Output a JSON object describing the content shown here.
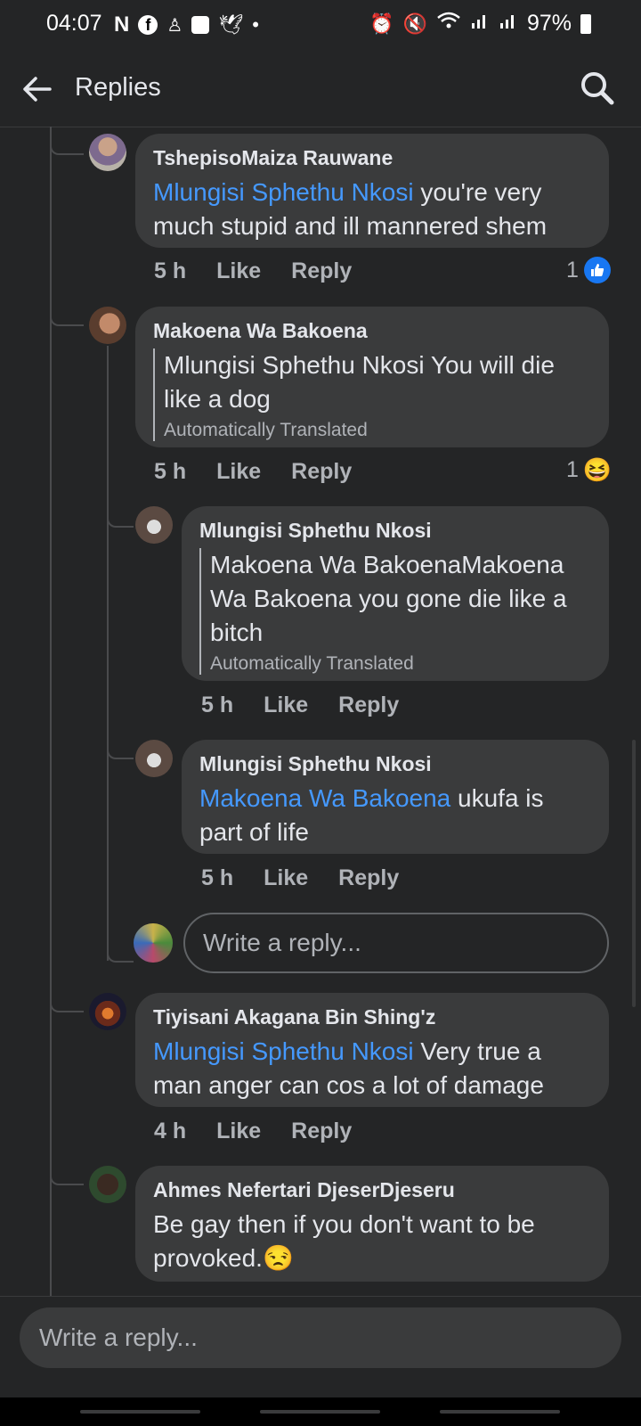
{
  "status": {
    "time": "04:07",
    "battery": "97%",
    "left_icons": [
      "netflix-icon",
      "facebook-icon",
      "snapchat-icon",
      "checkbox-icon",
      "twitter-icon",
      "dot-icon"
    ],
    "right_icons": [
      "alarm-icon",
      "mute-icon",
      "wifi-icon",
      "signal-icon",
      "signal-icon",
      "battery-icon"
    ]
  },
  "header": {
    "title": "Replies"
  },
  "comments": [
    {
      "name": "TshepisoMaiza Rauwane",
      "mention": "Mlungisi Sphethu Nkosi",
      "text": " you're very much stupid and ill mannered shem",
      "time": "5 h",
      "like": "Like",
      "reply": "Reply",
      "reaction_count": "1",
      "reaction": "like"
    },
    {
      "name": "Makoena Wa Bakoena",
      "text": "Mlungisi Sphethu Nkosi You will die like a dog",
      "translated": "Automatically Translated",
      "time": "5 h",
      "like": "Like",
      "reply": "Reply",
      "reaction_count": "1",
      "reaction": "haha"
    },
    {
      "name": "Mlungisi Sphethu Nkosi",
      "text": "Makoena Wa BakoenaMakoena Wa Bakoena you gone die like a bitch",
      "translated": "Automatically Translated",
      "time": "5 h",
      "like": "Like",
      "reply": "Reply"
    },
    {
      "name": "Mlungisi Sphethu Nkosi",
      "mention": "Makoena Wa Bakoena",
      "text": " ukufa is part of life",
      "time": "5 h",
      "like": "Like",
      "reply": "Reply"
    },
    {
      "name": "Tiyisani Akagana Bin Shing'z",
      "mention": "Mlungisi Sphethu Nkosi",
      "text": " Very true a man anger can cos a lot of damage",
      "time": "4 h",
      "like": "Like",
      "reply": "Reply"
    },
    {
      "name": "Ahmes Nefertari DjeserDjeseru",
      "text": "Be gay then if you don't want to be provoked.",
      "emoji": "😒"
    }
  ],
  "nested_reply_placeholder": "Write a reply...",
  "bottom_reply_placeholder": "Write a reply...",
  "colors": {
    "background": "#242526",
    "bubble": "#3a3b3c",
    "mention": "#4599ff",
    "like_blue": "#1877f2"
  }
}
